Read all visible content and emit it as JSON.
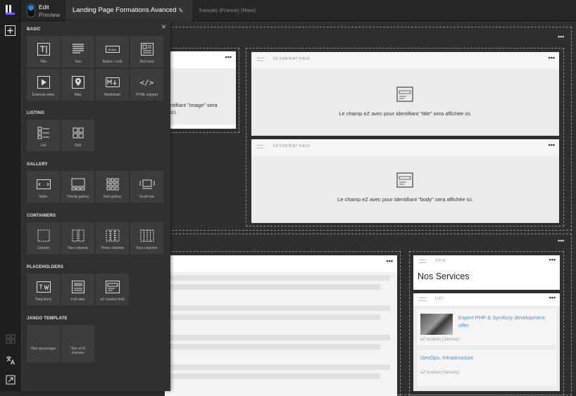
{
  "topbar": {
    "mode_edit": "Edit",
    "mode_preview": "Preview",
    "page_title": "Landing Page Formations Avanced",
    "language": "français (France) (Main)"
  },
  "panel": {
    "sections": [
      {
        "title": "BASIC",
        "items": [
          "Title",
          "Text",
          "Button / Link",
          "Rich text",
          "External video",
          "Map",
          "Markdown",
          "HTML snippet"
        ]
      },
      {
        "title": "LISTING",
        "items": [
          "List",
          "Grid"
        ]
      },
      {
        "title": "GALLERY",
        "items": [
          "Slider",
          "Thumb gallery",
          "Grid gallery",
          "Scroll bar"
        ]
      },
      {
        "title": "CONTAINERS",
        "items": [
          "Column",
          "Two columns",
          "Three columns",
          "Four columns"
        ]
      },
      {
        "title": "PLACEHOLDERS",
        "items": [
          "Twig block",
          "Full view",
          "eZ content field"
        ]
      },
      {
        "title": "JANGO TEMPLATE",
        "items": [
          "Titre dynamique",
          "Titre et fil d'ariane"
        ]
      }
    ],
    "button_tile_text": "Button"
  },
  "canvas": {
    "field_label": "EZ CONTENT FIELD",
    "image_text_fragment_1": "ntifiant \"image\" sera",
    "image_text_fragment_2": "ici.",
    "title_field_text": "Le champ eZ avec pour identifiant \"title\" sera affichée ici.",
    "body_field_text": "Le champ eZ avec pour identifiant \"body\" sera affichée ici.",
    "title_block_label": "TITLE",
    "title_block_heading": "Nos Services",
    "list_block_label": "LIST",
    "list_items": [
      {
        "title": "Expert PHP & Symfony development offer",
        "location": "eZ location (Service)"
      },
      {
        "title": "DevOps, Infrastructure",
        "location": "eZ location (Service)"
      }
    ],
    "menu_dots": "•••"
  },
  "colors": {
    "accent": "#1e88e5",
    "link": "#4a8fdc"
  }
}
